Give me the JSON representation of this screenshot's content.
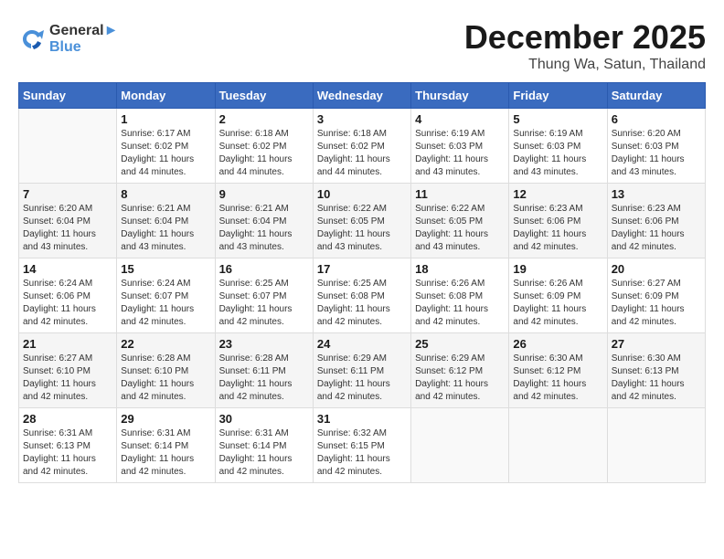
{
  "header": {
    "logo_line1": "General",
    "logo_line2": "Blue",
    "main_title": "December 2025",
    "sub_title": "Thung Wa, Satun, Thailand"
  },
  "calendar": {
    "weekdays": [
      "Sunday",
      "Monday",
      "Tuesday",
      "Wednesday",
      "Thursday",
      "Friday",
      "Saturday"
    ],
    "weeks": [
      [
        {
          "day": "",
          "info": ""
        },
        {
          "day": "1",
          "info": "Sunrise: 6:17 AM\nSunset: 6:02 PM\nDaylight: 11 hours\nand 44 minutes."
        },
        {
          "day": "2",
          "info": "Sunrise: 6:18 AM\nSunset: 6:02 PM\nDaylight: 11 hours\nand 44 minutes."
        },
        {
          "day": "3",
          "info": "Sunrise: 6:18 AM\nSunset: 6:02 PM\nDaylight: 11 hours\nand 44 minutes."
        },
        {
          "day": "4",
          "info": "Sunrise: 6:19 AM\nSunset: 6:03 PM\nDaylight: 11 hours\nand 43 minutes."
        },
        {
          "day": "5",
          "info": "Sunrise: 6:19 AM\nSunset: 6:03 PM\nDaylight: 11 hours\nand 43 minutes."
        },
        {
          "day": "6",
          "info": "Sunrise: 6:20 AM\nSunset: 6:03 PM\nDaylight: 11 hours\nand 43 minutes."
        }
      ],
      [
        {
          "day": "7",
          "info": "Sunrise: 6:20 AM\nSunset: 6:04 PM\nDaylight: 11 hours\nand 43 minutes."
        },
        {
          "day": "8",
          "info": "Sunrise: 6:21 AM\nSunset: 6:04 PM\nDaylight: 11 hours\nand 43 minutes."
        },
        {
          "day": "9",
          "info": "Sunrise: 6:21 AM\nSunset: 6:04 PM\nDaylight: 11 hours\nand 43 minutes."
        },
        {
          "day": "10",
          "info": "Sunrise: 6:22 AM\nSunset: 6:05 PM\nDaylight: 11 hours\nand 43 minutes."
        },
        {
          "day": "11",
          "info": "Sunrise: 6:22 AM\nSunset: 6:05 PM\nDaylight: 11 hours\nand 43 minutes."
        },
        {
          "day": "12",
          "info": "Sunrise: 6:23 AM\nSunset: 6:06 PM\nDaylight: 11 hours\nand 42 minutes."
        },
        {
          "day": "13",
          "info": "Sunrise: 6:23 AM\nSunset: 6:06 PM\nDaylight: 11 hours\nand 42 minutes."
        }
      ],
      [
        {
          "day": "14",
          "info": "Sunrise: 6:24 AM\nSunset: 6:06 PM\nDaylight: 11 hours\nand 42 minutes."
        },
        {
          "day": "15",
          "info": "Sunrise: 6:24 AM\nSunset: 6:07 PM\nDaylight: 11 hours\nand 42 minutes."
        },
        {
          "day": "16",
          "info": "Sunrise: 6:25 AM\nSunset: 6:07 PM\nDaylight: 11 hours\nand 42 minutes."
        },
        {
          "day": "17",
          "info": "Sunrise: 6:25 AM\nSunset: 6:08 PM\nDaylight: 11 hours\nand 42 minutes."
        },
        {
          "day": "18",
          "info": "Sunrise: 6:26 AM\nSunset: 6:08 PM\nDaylight: 11 hours\nand 42 minutes."
        },
        {
          "day": "19",
          "info": "Sunrise: 6:26 AM\nSunset: 6:09 PM\nDaylight: 11 hours\nand 42 minutes."
        },
        {
          "day": "20",
          "info": "Sunrise: 6:27 AM\nSunset: 6:09 PM\nDaylight: 11 hours\nand 42 minutes."
        }
      ],
      [
        {
          "day": "21",
          "info": "Sunrise: 6:27 AM\nSunset: 6:10 PM\nDaylight: 11 hours\nand 42 minutes."
        },
        {
          "day": "22",
          "info": "Sunrise: 6:28 AM\nSunset: 6:10 PM\nDaylight: 11 hours\nand 42 minutes."
        },
        {
          "day": "23",
          "info": "Sunrise: 6:28 AM\nSunset: 6:11 PM\nDaylight: 11 hours\nand 42 minutes."
        },
        {
          "day": "24",
          "info": "Sunrise: 6:29 AM\nSunset: 6:11 PM\nDaylight: 11 hours\nand 42 minutes."
        },
        {
          "day": "25",
          "info": "Sunrise: 6:29 AM\nSunset: 6:12 PM\nDaylight: 11 hours\nand 42 minutes."
        },
        {
          "day": "26",
          "info": "Sunrise: 6:30 AM\nSunset: 6:12 PM\nDaylight: 11 hours\nand 42 minutes."
        },
        {
          "day": "27",
          "info": "Sunrise: 6:30 AM\nSunset: 6:13 PM\nDaylight: 11 hours\nand 42 minutes."
        }
      ],
      [
        {
          "day": "28",
          "info": "Sunrise: 6:31 AM\nSunset: 6:13 PM\nDaylight: 11 hours\nand 42 minutes."
        },
        {
          "day": "29",
          "info": "Sunrise: 6:31 AM\nSunset: 6:14 PM\nDaylight: 11 hours\nand 42 minutes."
        },
        {
          "day": "30",
          "info": "Sunrise: 6:31 AM\nSunset: 6:14 PM\nDaylight: 11 hours\nand 42 minutes."
        },
        {
          "day": "31",
          "info": "Sunrise: 6:32 AM\nSunset: 6:15 PM\nDaylight: 11 hours\nand 42 minutes."
        },
        {
          "day": "",
          "info": ""
        },
        {
          "day": "",
          "info": ""
        },
        {
          "day": "",
          "info": ""
        }
      ]
    ]
  }
}
